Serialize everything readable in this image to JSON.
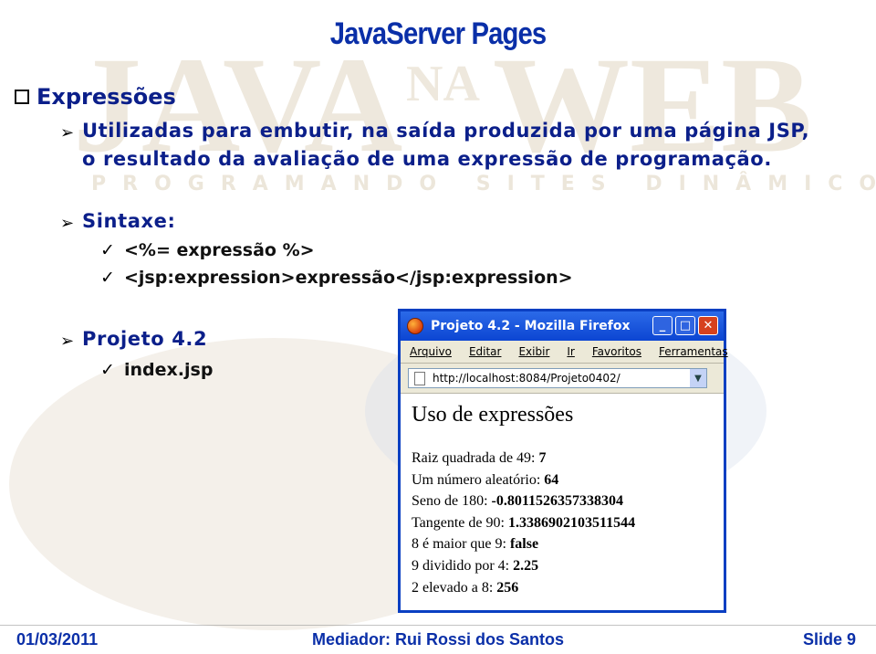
{
  "slide": {
    "title": "JavaServer Pages",
    "heading": "Expressões",
    "bullet1_line1": "Utilizadas para embutir, na saída produzida por uma página JSP,",
    "bullet1_line2": "o resultado da avaliação de uma expressão de programação.",
    "bullet2": "Sintaxe:",
    "syntax1": "<%= expressão %>",
    "syntax2": "<jsp:expression>expressão</jsp:expression>",
    "bullet3": "Projeto 4.2",
    "file": "index.jsp"
  },
  "watermark": {
    "logo_text": "JAVA NA WEB",
    "tagline": "PROGRAMANDO SITES DINÂMICOS"
  },
  "browser": {
    "window_title": "Projeto 4.2 - Mozilla Firefox",
    "menu": [
      "Arquivo",
      "Editar",
      "Exibir",
      "Ir",
      "Favoritos",
      "Ferramentas"
    ],
    "url": "http://localhost:8084/Projeto0402/",
    "page_heading": "Uso de expressões",
    "results": [
      {
        "label": "Raiz quadrada de 49:",
        "value": "7"
      },
      {
        "label": "Um número aleatório:",
        "value": "64"
      },
      {
        "label": "Seno de 180:",
        "value": "-0.8011526357338304"
      },
      {
        "label": "Tangente de 90:",
        "value": "1.3386902103511544"
      },
      {
        "label": "8 é maior que 9:",
        "value": "false"
      },
      {
        "label": "9 dividido por 4:",
        "value": "2.25"
      },
      {
        "label": "2 elevado a 8:",
        "value": "256"
      }
    ]
  },
  "footer": {
    "date": "01/03/2011",
    "mediator": "Mediador: Rui Rossi dos Santos",
    "slide": "Slide 9"
  }
}
